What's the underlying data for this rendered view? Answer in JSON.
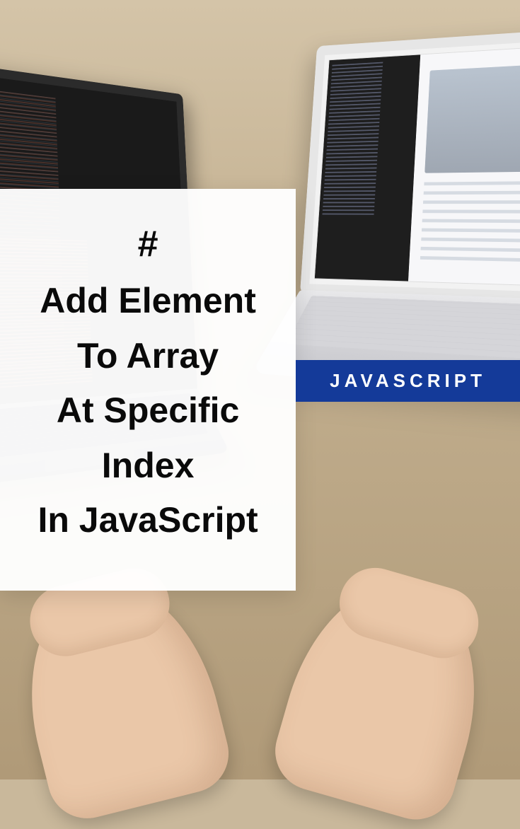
{
  "card": {
    "hash": "#",
    "lines": [
      "Add Element",
      "To Array",
      "At Specific Index",
      "In JavaScript"
    ]
  },
  "tag": {
    "label": "JAVASCRIPT"
  },
  "colors": {
    "tag_bg": "#143a99"
  }
}
